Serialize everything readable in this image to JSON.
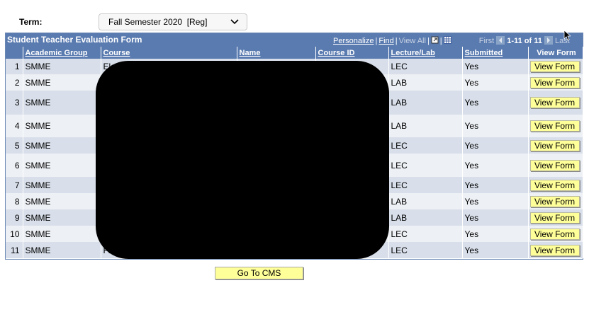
{
  "term": {
    "label": "Term:",
    "selected": "Fall Semester 2020  [Reg]"
  },
  "grid": {
    "title": "Student Teacher Evaluation Form",
    "nav": {
      "personalize": "Personalize",
      "find": "Find",
      "view_all": "View All",
      "first": "First",
      "range": "1-11 of 11",
      "last": "Last"
    },
    "columns": [
      "Academic Group",
      "Course",
      "Name",
      "Course ID",
      "Lecture/Lab",
      "Submitted",
      "View Form"
    ],
    "rows": [
      {
        "n": "1",
        "group": "SMME",
        "course": "Ele",
        "type": "LEC",
        "submitted": "Yes",
        "button": "View Form"
      },
      {
        "n": "2",
        "group": "SMME",
        "course": "",
        "type": "LAB",
        "submitted": "Yes",
        "button": "View Form"
      },
      {
        "n": "3",
        "group": "SMME",
        "course": "",
        "type": "LAB",
        "submitted": "Yes",
        "button": "View Form"
      },
      {
        "n": "4",
        "group": "SMME",
        "course": "",
        "type": "LAB",
        "submitted": "Yes",
        "button": "View Form"
      },
      {
        "n": "5",
        "group": "SMME",
        "course": "",
        "type": "LEC",
        "submitted": "Yes",
        "button": "View Form"
      },
      {
        "n": "6",
        "group": "SMME",
        "course": "",
        "type": "LEC",
        "submitted": "Yes",
        "button": "View Form"
      },
      {
        "n": "7",
        "group": "SMME",
        "course": "",
        "type": "LEC",
        "submitted": "Yes",
        "button": "View Form"
      },
      {
        "n": "8",
        "group": "SMME",
        "course": "",
        "type": "LAB",
        "submitted": "Yes",
        "button": "View Form"
      },
      {
        "n": "9",
        "group": "SMME",
        "course": "",
        "type": "LAB",
        "submitted": "Yes",
        "button": "View Form"
      },
      {
        "n": "10",
        "group": "SMME",
        "course": "",
        "type": "LEC",
        "submitted": "Yes",
        "button": "View Form"
      },
      {
        "n": "11",
        "group": "SMME",
        "course": "Flu",
        "type": "LEC",
        "submitted": "Yes",
        "button": "View Form"
      }
    ]
  },
  "footer": {
    "go_to_cms": "Go To CMS"
  },
  "colors": {
    "header_bg": "#5a7bb0",
    "row_odd": "#d8dfea",
    "row_even": "#edf0f4",
    "button_bg": "#ffff99"
  }
}
